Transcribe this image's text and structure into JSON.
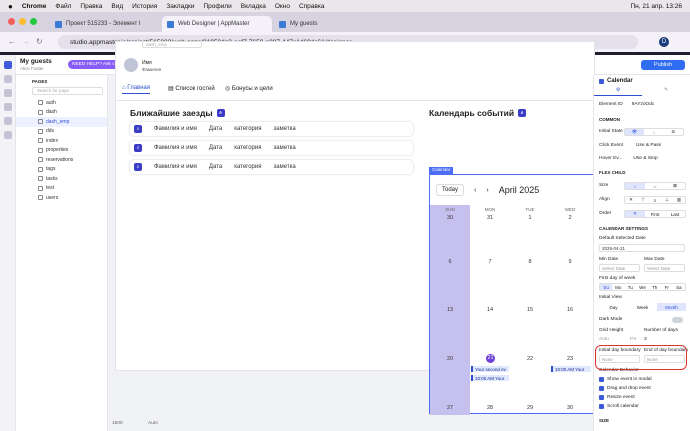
{
  "mac": {
    "apple": "",
    "app": "Chrome",
    "menus": [
      "Файл",
      "Правка",
      "Вид",
      "История",
      "Закладки",
      "Профили",
      "Вкладка",
      "Окно",
      "Справка"
    ],
    "datetime": "Пн, 21 апр.  13:26"
  },
  "browser": {
    "tabs": [
      "Проект 515233 - Элемент I",
      "Web Designer | AppMaster",
      "My guests"
    ],
    "url": "studio.appmaster.io/project/515233/web-apps/01958da3-eef7-7650-a887-447c1d69dc61/designer",
    "avatar": "D"
  },
  "app": {
    "title": "My guests",
    "subtitle": "Alice Foster",
    "help": "NEED HELP? Ask community!",
    "page_tab": "dash_emp",
    "publish": "Publish",
    "zoom": "1600",
    "auto": "Auto"
  },
  "pages": {
    "header": "PAGES",
    "search_placeholder": "Search for page",
    "items": [
      "auth",
      "dash",
      "dash_emp",
      "dds",
      "index",
      "properties",
      "reservations",
      "tags",
      "tasks",
      "test",
      "users"
    ],
    "selected": 2
  },
  "canvas": {
    "url": "dash_emp",
    "user_name": "Имя",
    "user_surname": "Фамилия",
    "nav": [
      "Главная",
      "Список гостей",
      "Бонусы и цели"
    ],
    "left_title": "Ближайшие заезды",
    "table_cols": [
      "Фамилия и имя",
      "Дата",
      "категория",
      "заметка"
    ],
    "right_title": "Календарь событий",
    "cal_tag": "Calendar"
  },
  "calendar": {
    "today": "Today",
    "month": "April 2025",
    "days": [
      "SUN",
      "MON",
      "TUE",
      "WED"
    ],
    "weeks": [
      [
        "30",
        "31",
        "1",
        "2"
      ],
      [
        "6",
        "7",
        "8",
        "9"
      ],
      [
        "13",
        "14",
        "15",
        "16"
      ],
      [
        "20",
        "21",
        "22",
        "23"
      ],
      [
        "27",
        "28",
        "29",
        "30"
      ]
    ],
    "events": [
      "Your second ev",
      "10:00 AM Your",
      "10:00 AM Your"
    ]
  },
  "right": {
    "title": "Calendar",
    "element_id_label": "Element ID",
    "element_id": "9AYzoOdc",
    "common": "COMMON",
    "initial_state": "Initial State",
    "click_event": "Click Event",
    "click_val": "Use & Pass",
    "hover_event": "Hover Ev...",
    "hover_val": "Use & Stop",
    "flex": "FLEX CHILD",
    "size": "Size",
    "align": "Align",
    "order": "Order",
    "first": "First",
    "last": "Last",
    "settings": "CALENDAR SETTINGS",
    "default_date_label": "Default Selected Date",
    "default_date": "2025-04-21",
    "min_date": "Min Date",
    "max_date": "Max Date",
    "select_date": "Select Date",
    "first_day": "First day of week",
    "weekdays": [
      "Su",
      "Mo",
      "Tu",
      "We",
      "Th",
      "Fr",
      "Sa"
    ],
    "initial_view": "Initial View",
    "views": [
      "Day",
      "Week",
      "Month"
    ],
    "dark_mode": "Dark Mode",
    "grid_height": "Grid Height",
    "num_days": "Number of days",
    "auto": "Auto",
    "px": "PX",
    "num": "3",
    "initial_boundary": "Initial day boundary",
    "end_boundary": "End of day boundary",
    "none": "None",
    "behavior": "Calendar Behavior",
    "checks": [
      "Show event in modal",
      "Drag and drop event",
      "Resize event",
      "Scroll calendar"
    ],
    "size_section": "SIZE"
  }
}
